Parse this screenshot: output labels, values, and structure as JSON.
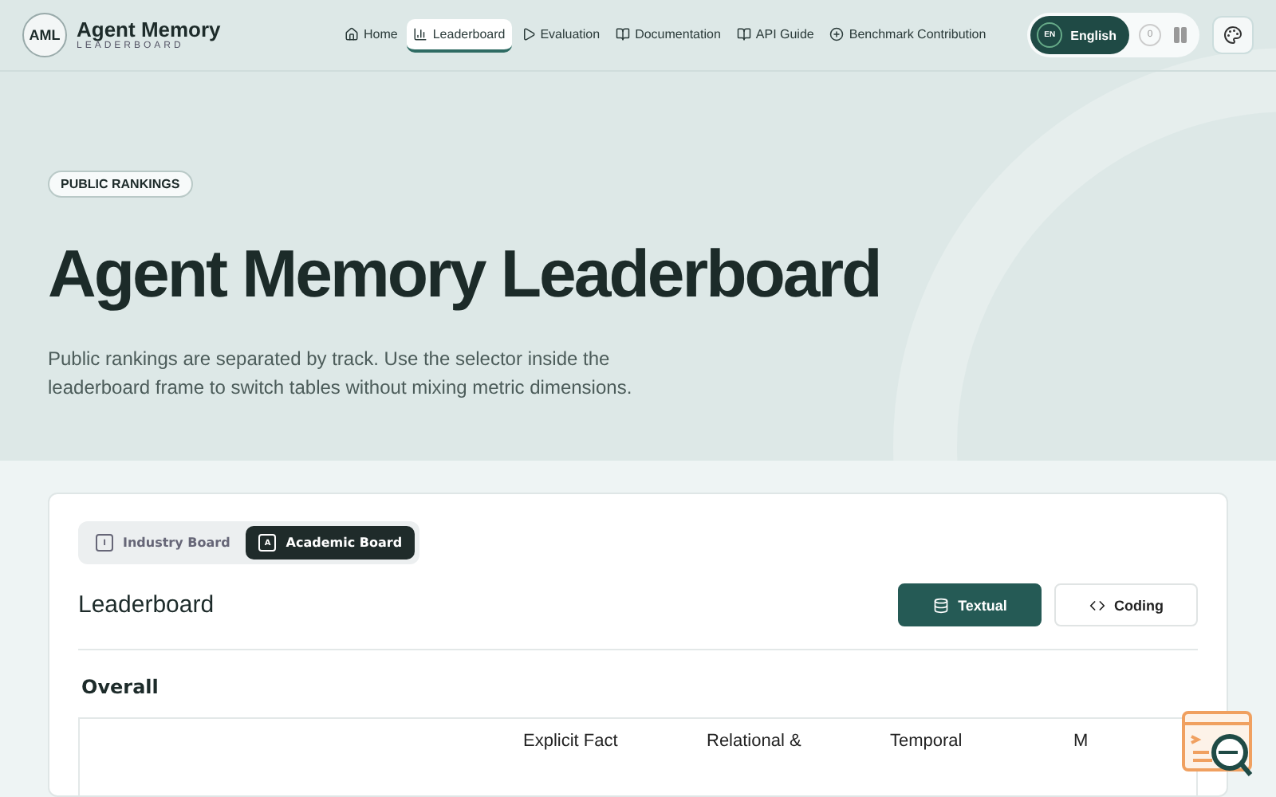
{
  "brand": {
    "logo": "AML",
    "name": "Agent Memory",
    "subtitle": "LEADERBOARD"
  },
  "nav": [
    {
      "label": "Home",
      "kind": "home",
      "selected": false
    },
    {
      "label": "Leaderboard",
      "kind": "chart",
      "selected": true
    },
    {
      "label": "Evaluation",
      "kind": "play",
      "selected": false
    },
    {
      "label": "Documentation",
      "kind": "book",
      "selected": false
    },
    {
      "label": "API Guide",
      "kind": "book",
      "selected": false
    },
    {
      "label": "Benchmark Contribution",
      "kind": "plus",
      "selected": false
    }
  ],
  "language": {
    "code": "EN",
    "label": "English",
    "toggle_mark": "0"
  },
  "hero": {
    "badge": "PUBLIC RANKINGS",
    "title": "Agent Memory Leaderboard",
    "description": "Public rankings are separated by track. Use the selector inside the leaderboard frame to switch tables without mixing metric dimensions."
  },
  "boards": [
    {
      "mark": "I",
      "label": "Industry Board",
      "selected": false
    },
    {
      "mark": "A",
      "label": "Academic Board",
      "selected": true
    }
  ],
  "section_title": "Leaderboard",
  "tracks": [
    {
      "label": "Textual",
      "kind": "database",
      "selected": true
    },
    {
      "label": "Coding",
      "kind": "code",
      "selected": false
    }
  ],
  "table_title": "Overall",
  "columns": [
    "Explicit Fact",
    "Relational &",
    "Temporal",
    "M"
  ]
}
